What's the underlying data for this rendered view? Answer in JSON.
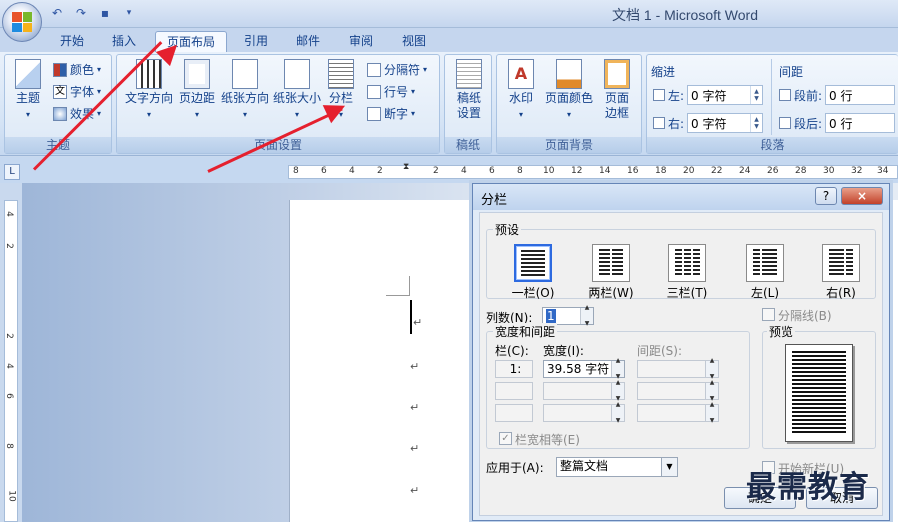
{
  "app": {
    "title": "文档 1 - Microsoft Word"
  },
  "tabs": [
    "开始",
    "插入",
    "页面布局",
    "引用",
    "邮件",
    "审阅",
    "视图"
  ],
  "active_tab": "页面布局",
  "ribbon": {
    "theme_group": {
      "label": "主题",
      "theme_btn": "主题",
      "colors": "颜色",
      "fonts": "字体",
      "effects": "效果"
    },
    "page_setup": {
      "label": "页面设置",
      "text_direction": "文字方向",
      "margins": "页边距",
      "orientation": "纸张方向",
      "size": "纸张大小",
      "columns": "分栏",
      "breaks": "分隔符",
      "line_numbers": "行号",
      "hyphenation": "断字"
    },
    "manuscript": {
      "label": "稿纸",
      "btn_line1": "稿纸",
      "btn_line2": "设置"
    },
    "page_background": {
      "label": "页面背景",
      "watermark": "水印",
      "page_color": "页面颜色",
      "borders_line1": "页面",
      "borders_line2": "边框"
    },
    "paragraph": {
      "label": "段落",
      "indent_title": "缩进",
      "left": "左:",
      "right": "右:",
      "indent_left_value": "0 字符",
      "indent_right_value": "0 字符",
      "spacing_title": "间距",
      "before": "段前:",
      "after": "段后:",
      "before_value": "0 行",
      "after_value": "0 行"
    }
  },
  "ruler": {
    "h_ticks": [
      "8",
      "6",
      "4",
      "2",
      "2",
      "4",
      "6",
      "8",
      "10",
      "12",
      "14",
      "16",
      "18",
      "20",
      "22",
      "24",
      "26",
      "28",
      "30",
      "32",
      "34"
    ],
    "v_ticks": [
      "4",
      "2",
      "2",
      "4",
      "6",
      "8",
      "10"
    ]
  },
  "dialog": {
    "title": "分栏",
    "help": "?",
    "close": "×",
    "presets_title": "预设",
    "presets": [
      "一栏(O)",
      "两栏(W)",
      "三栏(T)",
      "左(L)",
      "右(R)"
    ],
    "num_columns_label": "列数(N):",
    "num_columns_value": "1",
    "line_between_label": "分隔线(B)",
    "width_spacing_title": "宽度和间距",
    "col_header": "栏(C):",
    "width_header": "宽度(I):",
    "spacing_header": "间距(S):",
    "row1_col": "1:",
    "row1_width": "39.58 字符",
    "equal_width_label": "栏宽相等(E)",
    "apply_to_label": "应用于(A):",
    "apply_to_value": "整篇文档",
    "preview_title": "预览",
    "start_new_col_label": "开始新栏(U)",
    "ok": "确定",
    "cancel": "取消"
  },
  "watermark_text": "最需教育"
}
